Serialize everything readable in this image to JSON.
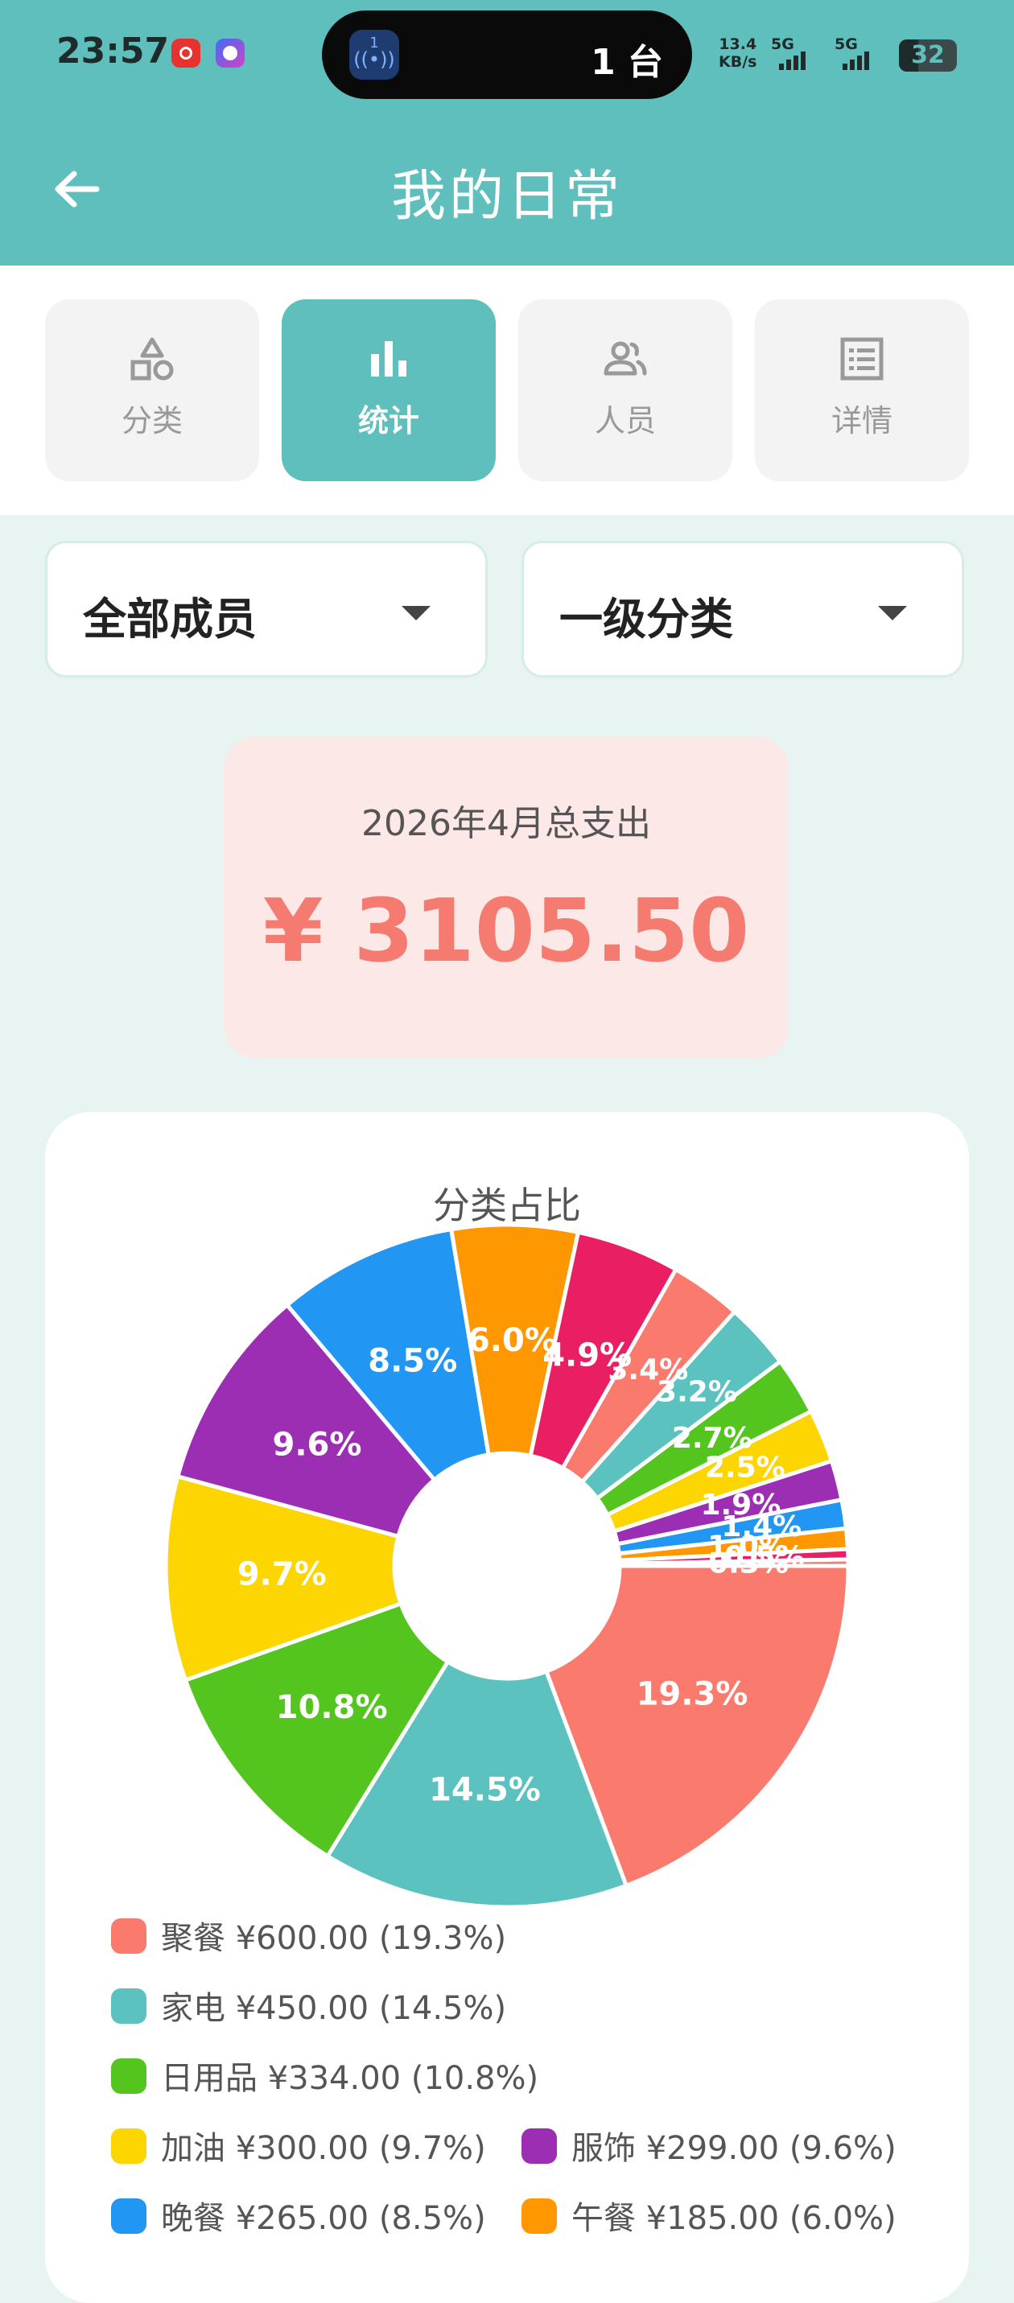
{
  "status": {
    "time": "23:57",
    "island_text": "1 台",
    "island_app_number": "1",
    "net_speed_value": "13.4",
    "net_speed_unit": "KB/s",
    "signal1": "5G",
    "signal2": "5G",
    "battery": "32"
  },
  "header": {
    "title": "我的日常"
  },
  "tabs": [
    {
      "label": "分类",
      "icon": "shapes-icon",
      "active": false
    },
    {
      "label": "统计",
      "icon": "bar-chart-icon",
      "active": true
    },
    {
      "label": "人员",
      "icon": "people-icon",
      "active": false
    },
    {
      "label": "详情",
      "icon": "list-icon",
      "active": false
    }
  ],
  "filters": {
    "member": "全部成员",
    "level": "一级分类"
  },
  "summary": {
    "label": "2026年4月总支出",
    "amount": "¥ 3105.50"
  },
  "chart_data": {
    "type": "pie",
    "title": "分类占比",
    "donut": true,
    "values": [
      600,
      450,
      334,
      300,
      299,
      265,
      185,
      152,
      105,
      98,
      85,
      78,
      58,
      42,
      30,
      15,
      9.5
    ],
    "labels": [
      "19.3%",
      "14.5%",
      "10.8%",
      "9.7%",
      "9.6%",
      "8.5%",
      "6.0%",
      "4.9%",
      "3.4%",
      "3.2%",
      "2.7%",
      "2.5%",
      "1.9%",
      "1.4%",
      "1.0%",
      "0.5%",
      "0.3%"
    ],
    "colors": [
      "#fa7b6e",
      "#5cc2bf",
      "#54c41f",
      "#fdd500",
      "#9c2eb3",
      "#2196f3",
      "#ff9800",
      "#e91e63",
      "#fa7b6e",
      "#5cc2bf",
      "#54c41f",
      "#fdd500",
      "#9c2eb3",
      "#2196f3",
      "#ff9800",
      "#e91e63",
      "#fa7b6e"
    ]
  },
  "legend": [
    {
      "text": "聚餐 ¥600.00 (19.3%)",
      "color": "#fa7b6e"
    },
    {
      "text": "家电 ¥450.00 (14.5%)",
      "color": "#5cc2bf"
    },
    {
      "text": "日用品 ¥334.00 (10.8%)",
      "color": "#54c41f"
    },
    {
      "text": "加油 ¥300.00 (9.7%)",
      "color": "#fdd500"
    },
    {
      "text": "服饰 ¥299.00 (9.6%)",
      "color": "#9c2eb3"
    },
    {
      "text": "晚餐 ¥265.00 (8.5%)",
      "color": "#2196f3"
    },
    {
      "text": "午餐 ¥185.00 (6.0%)",
      "color": "#ff9800"
    }
  ]
}
